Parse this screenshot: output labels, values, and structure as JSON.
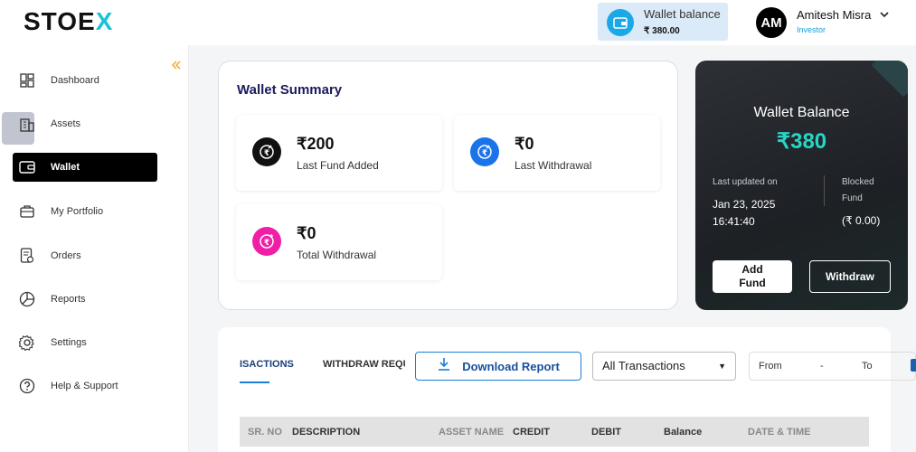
{
  "header": {
    "logo_main": "STOE",
    "logo_accent": "X",
    "wallet_label": "Wallet balance",
    "wallet_value": "₹ 380.00",
    "avatar_initials": "AM",
    "user_name": "Amitesh Misra",
    "user_role": "Investor"
  },
  "sidebar": {
    "items": [
      {
        "label": "Dashboard",
        "icon": "dashboard-icon"
      },
      {
        "label": "Assets",
        "icon": "building-icon"
      },
      {
        "label": "Wallet",
        "icon": "wallet-icon"
      },
      {
        "label": "My Portfolio",
        "icon": "briefcase-icon"
      },
      {
        "label": "Orders",
        "icon": "orders-icon"
      },
      {
        "label": "Reports",
        "icon": "pie-chart-icon"
      },
      {
        "label": "Settings",
        "icon": "gear-icon"
      },
      {
        "label": "Help & Support",
        "icon": "help-icon"
      }
    ],
    "active": "Wallet"
  },
  "summary": {
    "title": "Wallet Summary",
    "stats": [
      {
        "amount": "₹200",
        "label": "Last Fund Added",
        "color": "#111111"
      },
      {
        "amount": "₹0",
        "label": "Last Withdrawal",
        "color": "#1a73e8"
      },
      {
        "amount": "₹0",
        "label": "Total Withdrawal",
        "color": "#f01fa6"
      }
    ]
  },
  "balance": {
    "title": "Wallet Balance",
    "amount": "₹380",
    "updated_label": "Last updated on",
    "updated_date": "Jan 23, 2025",
    "updated_time": "16:41:40",
    "blocked_label_1": "Blocked",
    "blocked_label_2": "Fund",
    "blocked_value": "(₹ 0.00)",
    "add_label_1": "Add",
    "add_label_2": "Fund",
    "withdraw_label": "Withdraw"
  },
  "transactions": {
    "tab_1": "ISACTIONS",
    "tab_2": "WITHDRAW REQUESTS",
    "download_label": "Download Report",
    "filter_value": "All Transactions",
    "from_label": "From",
    "dash": "-",
    "to_label": "To",
    "columns": [
      "SR. NO",
      "DESCRIPTION",
      "ASSET NAME",
      "CREDIT",
      "DEBIT",
      "Balance",
      "DATE & TIME"
    ]
  },
  "colors": {
    "accent": "#17c3d6",
    "balance_green": "#26d6c6",
    "link_blue": "#1a7fd6"
  }
}
